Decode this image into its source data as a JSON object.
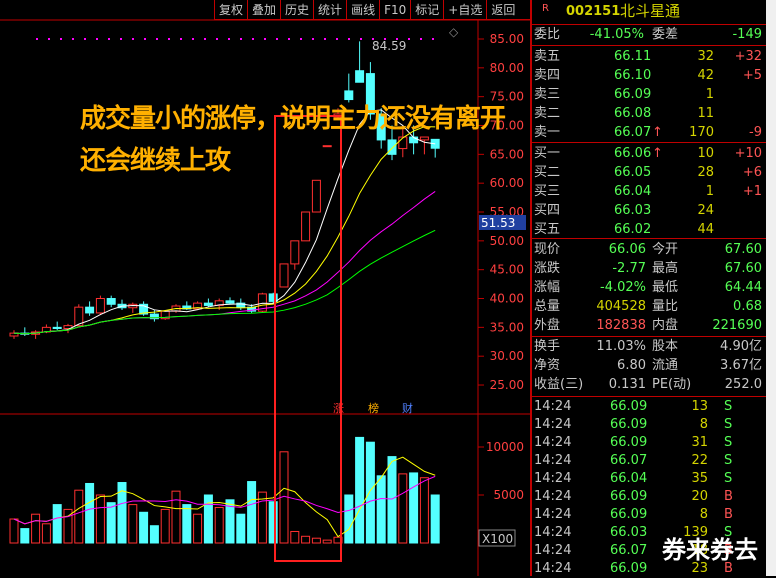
{
  "toolbar": [
    "复权",
    "叠加",
    "历史",
    "统计",
    "画线",
    "F10",
    "标记",
    "+自选",
    "返回"
  ],
  "chart_data": {
    "type": "candlestick",
    "price_ticks": [
      "85.00",
      "80.00",
      "75.00",
      "70.00",
      "65.00",
      "60.00",
      "55.00",
      "50.00",
      "45.00",
      "40.00",
      "35.00",
      "30.00",
      "25.00"
    ],
    "price_values": [
      85,
      80,
      75,
      70,
      65,
      60,
      55,
      50,
      45,
      40,
      35,
      30,
      25
    ],
    "volume_ticks": [
      "10000",
      "5000"
    ],
    "volume_values": [
      10000,
      5000
    ],
    "volume_unit": "X100",
    "high_label": "84.59",
    "current_price_label": "51.53",
    "event_tags": [
      "涨",
      "榜",
      "财"
    ],
    "candles": [
      [
        33.5,
        34.5,
        33,
        34
      ],
      [
        34,
        35,
        33.5,
        33.8
      ],
      [
        33.8,
        34.5,
        33,
        34.2
      ],
      [
        34.2,
        35.5,
        34,
        35
      ],
      [
        35,
        36,
        34.5,
        34.8
      ],
      [
        34.8,
        35.6,
        34,
        35.3
      ],
      [
        35.3,
        39,
        35,
        38.5
      ],
      [
        38.5,
        39.5,
        37,
        37.5
      ],
      [
        37.5,
        40.5,
        37.2,
        40
      ],
      [
        40,
        40.5,
        38.5,
        39
      ],
      [
        39,
        39.8,
        38,
        38.4
      ],
      [
        38.4,
        39.3,
        37.5,
        39
      ],
      [
        39,
        39.5,
        37,
        37.3
      ],
      [
        37.3,
        38,
        36,
        36.5
      ],
      [
        36.5,
        38,
        36.3,
        37.8
      ],
      [
        37.8,
        39,
        37.5,
        38.7
      ],
      [
        38.7,
        39.5,
        38,
        38.2
      ],
      [
        38.2,
        39.5,
        38,
        39.2
      ],
      [
        39.2,
        40,
        38.5,
        38.8
      ],
      [
        38.8,
        40,
        38,
        39.6
      ],
      [
        39.6,
        40.2,
        39,
        39.2
      ],
      [
        39.2,
        40,
        38,
        38.5
      ],
      [
        38.5,
        39,
        37.5,
        37.8
      ],
      [
        37.8,
        41,
        37.5,
        40.8
      ],
      [
        40.8,
        41,
        39,
        39.5
      ],
      [
        42,
        46,
        42,
        46
      ],
      [
        46,
        50,
        45,
        50
      ],
      [
        50,
        55,
        50,
        55
      ],
      [
        55,
        60.5,
        55,
        60.5
      ],
      [
        66.5,
        66.5,
        66.5,
        66.5
      ],
      [
        71.5,
        73,
        71,
        72
      ],
      [
        76,
        79,
        74,
        74.5
      ],
      [
        79.5,
        84.59,
        78,
        77.5
      ],
      [
        79,
        81,
        71,
        72
      ],
      [
        72,
        73,
        66,
        67.5
      ],
      [
        67.5,
        70,
        64,
        65
      ],
      [
        66,
        70,
        64.5,
        68
      ],
      [
        68,
        70,
        65,
        67
      ],
      [
        67.5,
        68,
        65,
        68
      ],
      [
        67.6,
        67.6,
        64.44,
        66.06
      ]
    ],
    "volumes": [
      2500,
      1500,
      3000,
      2000,
      4000,
      3500,
      5500,
      6200,
      5000,
      4200,
      6300,
      4000,
      3200,
      1800,
      3500,
      5400,
      4000,
      3000,
      5000,
      3700,
      4500,
      3000,
      6400,
      5300,
      4300,
      9500,
      1200,
      700,
      500,
      300,
      600,
      5000,
      11000,
      10500,
      7000,
      9000,
      7200,
      7300,
      6800,
      5000
    ],
    "ma_colors": [
      "#ffffff",
      "#ffff00",
      "#ff00ff",
      "#00ff00"
    ]
  },
  "annotation": {
    "line1": "成交量小的涨停，说明主力还没有离开",
    "line2": "还会继续上攻"
  },
  "watermark": "券来券去",
  "quote": {
    "flag": "R",
    "code": "002151",
    "name": "北斗星通",
    "weibi_label": "委比",
    "weibi": "-41.05%",
    "weicha_label": "委差",
    "weicha": "-149",
    "asks": [
      {
        "label": "卖五",
        "price": "66.11",
        "vol": "32",
        "chg": "+32"
      },
      {
        "label": "卖四",
        "price": "66.10",
        "vol": "42",
        "chg": "+5"
      },
      {
        "label": "卖三",
        "price": "66.09",
        "vol": "1",
        "chg": ""
      },
      {
        "label": "卖二",
        "price": "66.08",
        "vol": "11",
        "chg": ""
      },
      {
        "label": "卖一",
        "price": "66.07",
        "vol": "170",
        "chg": "-9",
        "arrow": "↑"
      }
    ],
    "bids": [
      {
        "label": "买一",
        "price": "66.06",
        "vol": "10",
        "chg": "+10",
        "arrow": "↑"
      },
      {
        "label": "买二",
        "price": "66.05",
        "vol": "28",
        "chg": "+6"
      },
      {
        "label": "买三",
        "price": "66.04",
        "vol": "1",
        "chg": "+1"
      },
      {
        "label": "买四",
        "price": "66.03",
        "vol": "24",
        "chg": ""
      },
      {
        "label": "买五",
        "price": "66.02",
        "vol": "44",
        "chg": ""
      }
    ],
    "stats": [
      [
        "现价",
        "66.06",
        "今开",
        "67.60"
      ],
      [
        "涨跌",
        "-2.77",
        "最高",
        "67.60"
      ],
      [
        "涨幅",
        "-4.02%",
        "最低",
        "64.44"
      ],
      [
        "总量",
        "404528",
        "量比",
        "0.68"
      ],
      [
        "外盘",
        "182838",
        "内盘",
        "221690"
      ]
    ],
    "fund": [
      [
        "换手",
        "11.03%",
        "股本",
        "4.90亿"
      ],
      [
        "净资",
        "6.80",
        "流通",
        "3.67亿"
      ],
      [
        "收益(三)",
        "0.131",
        "PE(动)",
        "252.0"
      ]
    ],
    "ticks": [
      [
        "14:24",
        "66.09",
        "13",
        "S"
      ],
      [
        "14:24",
        "66.09",
        "8",
        "S"
      ],
      [
        "14:24",
        "66.09",
        "31",
        "S"
      ],
      [
        "14:24",
        "66.07",
        "22",
        "S"
      ],
      [
        "14:24",
        "66.04",
        "35",
        "S"
      ],
      [
        "14:24",
        "66.09",
        "20",
        "B"
      ],
      [
        "14:24",
        "66.09",
        "8",
        "B"
      ],
      [
        "14:24",
        "66.03",
        "139",
        "S"
      ],
      [
        "14:24",
        "66.07",
        "18",
        "B"
      ],
      [
        "14:24",
        "66.09",
        "23",
        "B"
      ]
    ]
  }
}
